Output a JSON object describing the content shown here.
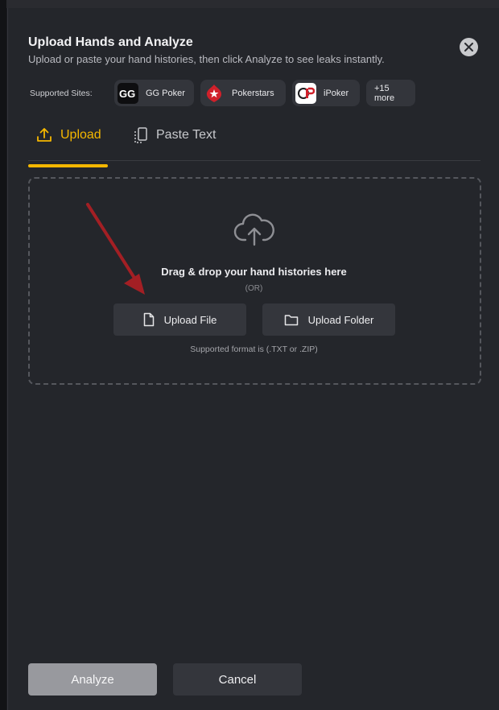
{
  "modal": {
    "title": "Upload Hands and Analyze",
    "subtitle": "Upload or paste your hand histories, then click Analyze to see leaks instantly."
  },
  "supported_sites": {
    "label": "Supported Sites:",
    "sites": [
      {
        "name": "GG Poker",
        "icon": "gg-poker-logo"
      },
      {
        "name": "Pokerstars",
        "icon": "pokerstars-logo"
      },
      {
        "name": "iPoker",
        "icon": "ipoker-logo"
      }
    ],
    "more": "+15 more"
  },
  "tabs": [
    {
      "label": "Upload",
      "icon": "upload-icon",
      "active": true
    },
    {
      "label": "Paste Text",
      "icon": "paste-text-icon",
      "active": false
    }
  ],
  "dropzone": {
    "title": "Drag & drop your hand histories here",
    "or": "(OR)",
    "upload_file": "Upload File",
    "upload_folder": "Upload Folder",
    "format_note": "Supported format is (.TXT or .ZIP)"
  },
  "footer": {
    "analyze": "Analyze",
    "cancel": "Cancel"
  },
  "colors": {
    "accent": "#f5b700",
    "modal_bg": "#24262b",
    "button_bg": "#34363c",
    "annotation_arrow": "#a31f24"
  }
}
